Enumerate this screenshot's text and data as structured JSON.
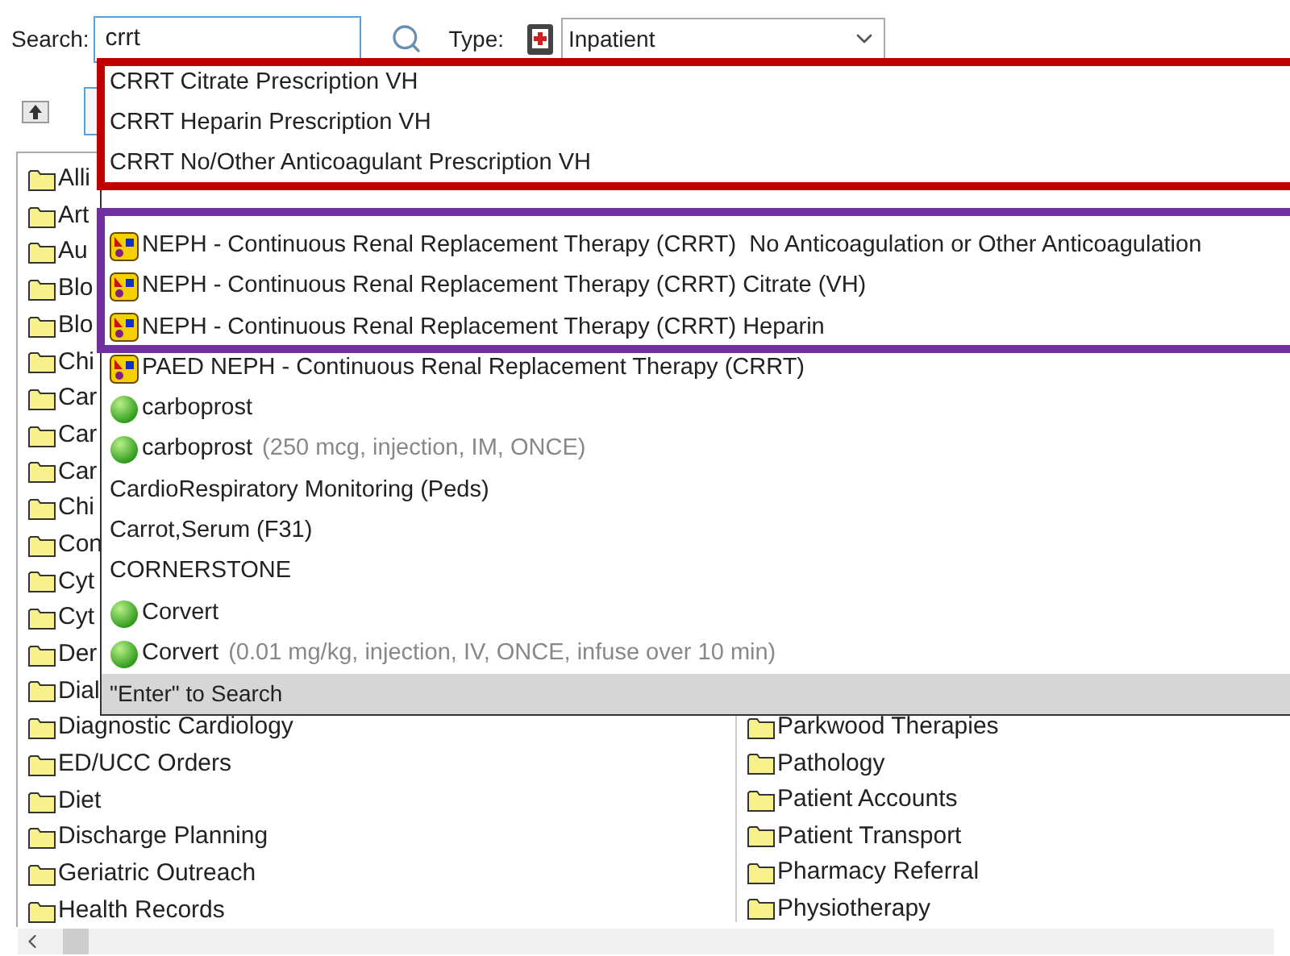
{
  "search": {
    "label": "Search:",
    "value": "crrt"
  },
  "type": {
    "label": "Type:",
    "value": "Inpatient"
  },
  "tree": {
    "left": [
      "Alli",
      "Art",
      "Au",
      "Blo",
      "Blo",
      "Chi",
      "Car",
      "Car",
      "Car",
      "Chi",
      "Con",
      "Cyt",
      "Cyt",
      "Der",
      "Dial",
      "Diagnostic Cardiology",
      "ED/UCC Orders",
      "Diet",
      "Discharge Planning",
      "Geriatric Outreach",
      "Health Records"
    ],
    "right": [
      "Parkwood Therapies",
      "Pathology",
      "Patient Accounts",
      "Patient Transport",
      "Pharmacy Referral",
      "Physiotherapy"
    ]
  },
  "suggestions": [
    {
      "kind": "plain",
      "text": "CRRT Citrate Prescription VH"
    },
    {
      "kind": "plain",
      "text": "CRRT Heparin Prescription VH"
    },
    {
      "kind": "plain",
      "text": "CRRT No/Other Anticoagulant Prescription VH"
    },
    {
      "kind": "hidden"
    },
    {
      "kind": "plan",
      "text": "NEPH - Continuous Renal Replacement Therapy (CRRT)  No Anticoagulation or Other Anticoagulation"
    },
    {
      "kind": "plan",
      "text": "NEPH - Continuous Renal Replacement Therapy (CRRT) Citrate (VH)"
    },
    {
      "kind": "plan",
      "text": "NEPH - Continuous Renal Replacement Therapy (CRRT) Heparin"
    },
    {
      "kind": "plan",
      "text": "PAED NEPH - Continuous Renal Replacement Therapy (CRRT)"
    },
    {
      "kind": "med",
      "text": "carboprost"
    },
    {
      "kind": "med",
      "text": "carboprost",
      "detail": "(250 mcg, injection, IM, ONCE)"
    },
    {
      "kind": "plain",
      "text": "CardioRespiratory Monitoring (Peds)"
    },
    {
      "kind": "plain",
      "text": "Carrot,Serum (F31)"
    },
    {
      "kind": "plain",
      "text": "CORNERSTONE"
    },
    {
      "kind": "med",
      "text": "Corvert"
    },
    {
      "kind": "med",
      "text": "Corvert",
      "detail": "(0.01 mg/kg, injection, IV, ONCE, infuse over 10 min)"
    }
  ],
  "footer": "\"Enter\" to Search",
  "highlights": [
    {
      "color": "#c00000"
    },
    {
      "color": "#7030a0"
    }
  ]
}
